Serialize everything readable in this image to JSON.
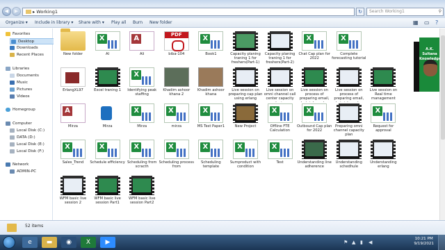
{
  "window": {
    "address": "Working1",
    "search_placeholder": "Search Working1"
  },
  "toolbar": {
    "organize": "Organize ▾",
    "include": "Include in library ▾",
    "share": "Share with ▾",
    "playall": "Play all",
    "burn": "Burn",
    "newfolder": "New folder"
  },
  "nav": {
    "favorites": "Favorites",
    "desktop": "Desktop",
    "downloads": "Downloads",
    "recent": "Recent Places",
    "libraries": "Libraries",
    "documents": "Documents",
    "music": "Music",
    "pictures": "Pictures",
    "videos": "Videos",
    "homegroup": "Homegroup",
    "computer": "Computer",
    "diskc": "Local Disk (C:)",
    "datad": "DATA (D:)",
    "diske": "Local Disk (E:)",
    "diskf": "Local Disk (F:)",
    "network": "Network",
    "adminpc": "ADMIN-PC"
  },
  "files": [
    {
      "name": "New folder",
      "type": "folder"
    },
    {
      "name": "AI",
      "type": "xls"
    },
    {
      "name": "Ali",
      "type": "acc"
    },
    {
      "name": "biba-104",
      "type": "pdf"
    },
    {
      "name": "Book1",
      "type": "xls"
    },
    {
      "name": "Capacity planing traning 1 for freshers(Part-1)",
      "type": "vid",
      "color": "#4b9a63"
    },
    {
      "name": "Capacity planing traning 1 for freshers(Part-2)",
      "type": "vid",
      "color": "#e8eef5"
    },
    {
      "name": "Chat Cap plan for 2022",
      "type": "xls"
    },
    {
      "name": "Complete forecasting tutorial",
      "type": "xls"
    },
    {
      "name": "",
      "type": "none"
    },
    {
      "name": "ErlangXL97",
      "type": "access2"
    },
    {
      "name": "Excel traning 1",
      "type": "vid",
      "color": "#2e8a4f"
    },
    {
      "name": "Identifying peak staffing",
      "type": "xls"
    },
    {
      "name": "Khadim ashoor khana 2",
      "type": "img",
      "color": "#5c6e5a"
    },
    {
      "name": "Khadim ashoor khana",
      "type": "img",
      "color": "#9a7a5a"
    },
    {
      "name": "Live session on preparing cap plan using erlang",
      "type": "vid",
      "color": "#e8eef5"
    },
    {
      "name": "Live session on omni channel call center capacity planing",
      "type": "vid",
      "color": "#e8eef5"
    },
    {
      "name": "Live session on process of preparing email, chat, inbound, ...",
      "type": "vid",
      "color": "#2e8a4f"
    },
    {
      "name": "Live session on process of preparing email, chat, inbound, ...",
      "type": "vid",
      "color": "#e8eef5"
    },
    {
      "name": "Live session on Real time management",
      "type": "vid",
      "color": "#2e8a4f"
    },
    {
      "name": "Mirza",
      "type": "acc"
    },
    {
      "name": "Mirza",
      "type": "mp3"
    },
    {
      "name": "Mirza",
      "type": "xls"
    },
    {
      "name": "mirza",
      "type": "xls"
    },
    {
      "name": "MS Test Paper1",
      "type": "xls"
    },
    {
      "name": "New Project",
      "type": "vid",
      "color": "#8a6a3a"
    },
    {
      "name": "Offline FTE Calculation",
      "type": "xls"
    },
    {
      "name": "Outbound Cap plan for 2022",
      "type": "xls"
    },
    {
      "name": "Preparing omni channel capacity plan",
      "type": "vid",
      "color": "#e8eef5"
    },
    {
      "name": "Request for approval",
      "type": "xls"
    },
    {
      "name": "Sales_Trend",
      "type": "xls"
    },
    {
      "name": "Schedule efficiency",
      "type": "xls"
    },
    {
      "name": "Scheduling from scracth",
      "type": "xls"
    },
    {
      "name": "Scheduling process from",
      "type": "xls"
    },
    {
      "name": "Scheduling template",
      "type": "xls"
    },
    {
      "name": "Sumproduct with condition",
      "type": "xls"
    },
    {
      "name": "Test",
      "type": "xls"
    },
    {
      "name": "Understanding line adherence",
      "type": "vid",
      "color": "#3a6a4a"
    },
    {
      "name": "Understanding schedhule",
      "type": "vid",
      "color": "#e8eef5"
    },
    {
      "name": "Understanding erlang",
      "type": "vid",
      "color": "#e8eef5"
    },
    {
      "name": "WFM basic live session 2",
      "type": "vid",
      "color": "#e8eef5"
    },
    {
      "name": "WFM basic live session Part1",
      "type": "vid",
      "color": "#2e8a4f"
    },
    {
      "name": "WFM basic live session Part2",
      "type": "vid",
      "color": "#2e8a4f"
    }
  ],
  "overlay": {
    "line1": "A.K. Sultana",
    "line2": "Knowledge"
  },
  "status": {
    "items": "52 items"
  },
  "taskbar": {
    "time": "10:21 PM",
    "date": "9/19/2021"
  }
}
